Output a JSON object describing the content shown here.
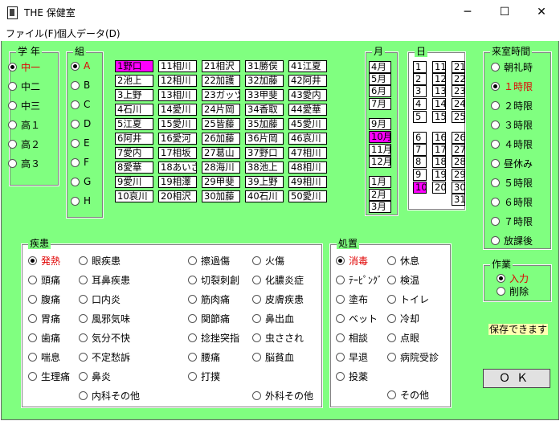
{
  "window": {
    "title": "THE 保健室",
    "minimize": "─",
    "maximize": "☐",
    "close": "✕"
  },
  "menu": [
    {
      "label": "ファイル(F)"
    },
    {
      "label": "個人データ(D)"
    }
  ],
  "grade": {
    "title": "学 年",
    "options": [
      "中一",
      "中二",
      "中三",
      "高１",
      "高２",
      "高３"
    ],
    "selected": 0
  },
  "class": {
    "title": "組",
    "options": [
      "A",
      "B",
      "C",
      "D",
      "E",
      "F",
      "G",
      "H"
    ],
    "selected": 0
  },
  "students": [
    [
      "1野口",
      "2池上",
      "3上野",
      "4石川",
      "5江夏",
      "6阿井",
      "7愛内",
      "8愛華",
      "9愛川",
      "10哀川"
    ],
    [
      "11相川",
      "12相川",
      "13相川",
      "14愛川",
      "15愛川",
      "16愛河",
      "17相坂",
      "18あいざ",
      "19相澤",
      "20相沢"
    ],
    [
      "21相沢",
      "22加護",
      "23ガッツ",
      "24片岡",
      "25皆藤",
      "26加藤",
      "27葛山",
      "28海川",
      "29甲斐",
      "30加藤"
    ],
    [
      "31勝俣",
      "32加藤",
      "33甲斐",
      "34香取",
      "35加藤",
      "36片岡",
      "37野口",
      "38池上",
      "39上野",
      "40石川"
    ],
    [
      "41江夏",
      "42阿井",
      "43愛内",
      "44愛華",
      "45愛川",
      "46哀川",
      "47相川",
      "48相川",
      "49相川",
      "50愛川"
    ]
  ],
  "students_selected": "1野口",
  "month": {
    "title": "月",
    "items": [
      "4月",
      "5月",
      "6月",
      "7月",
      "9月",
      "10月",
      "11月",
      "12月",
      "1月",
      "2月",
      "3月"
    ],
    "selected": "10月"
  },
  "day": {
    "title": "日",
    "items": [
      "1",
      "2",
      "3",
      "4",
      "5",
      "6",
      "7",
      "8",
      "9",
      "10",
      "11",
      "12",
      "13",
      "14",
      "15",
      "16",
      "17",
      "18",
      "19",
      "20",
      "21",
      "22",
      "23",
      "24",
      "25",
      "26",
      "27",
      "28",
      "29",
      "30",
      "31"
    ],
    "selected": "10"
  },
  "period": {
    "title": "来室時間",
    "options": [
      "朝礼時",
      "１時限",
      "２時限",
      "３時限",
      "４時限",
      "昼休み",
      "５時限",
      "６時限",
      "７時限",
      "放課後"
    ],
    "selected": 1
  },
  "illness": {
    "title": "疾患",
    "items": [
      "発熱",
      "頭痛",
      "腹痛",
      "胃痛",
      "歯痛",
      "喘息",
      "生理痛",
      "眼疾患",
      "耳鼻疾患",
      "口内炎",
      "風邪気味",
      "気分不快",
      "不定愁訴",
      "鼻炎",
      "内科その他",
      "擦過傷",
      "切裂刺創",
      "筋肉痛",
      "関節痛",
      "捻挫突指",
      "腰痛",
      "打撲",
      "火傷",
      "化膿炎症",
      "皮膚疾患",
      "鼻出血",
      "虫さされ",
      "脳貧血",
      "外科その他"
    ],
    "selected": "発熱"
  },
  "treatment": {
    "title": "処置",
    "items": [
      "消毒",
      "ﾃｰﾋﾟﾝｸﾞ",
      "塗布",
      "ベット",
      "相談",
      "早退",
      "投薬",
      "休息",
      "検温",
      "トイレ",
      "冷却",
      "点眼",
      "病院受診",
      "その他"
    ],
    "selected": "消毒"
  },
  "work": {
    "title": "作業",
    "options": [
      "入力",
      "削除"
    ],
    "selected": 0
  },
  "status": {
    "text": "保存できます"
  },
  "ok": {
    "label": "ＯＫ"
  },
  "colors": {
    "background": "#80ff80",
    "selected_cell": "#ff00ff",
    "selected_text": "#e00000",
    "status_bg": "#ffffb0"
  }
}
